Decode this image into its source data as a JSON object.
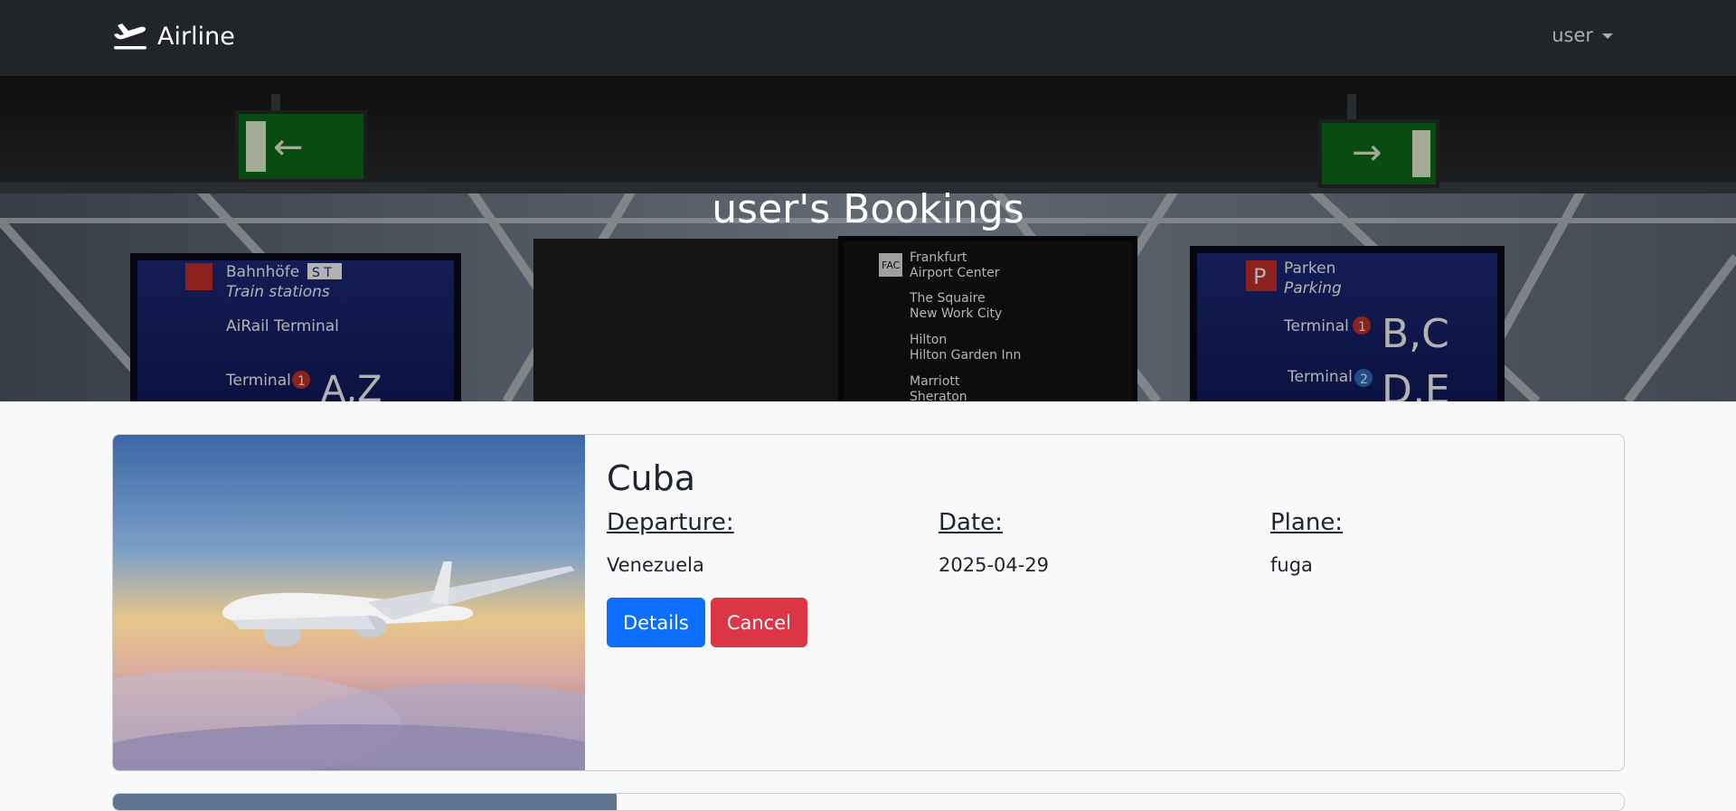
{
  "navbar": {
    "brand": "Airline",
    "brand_icon": "plane-departure-icon",
    "user_label": "user",
    "dropdown_icon": "caret-down-icon"
  },
  "hero": {
    "title": "user's Bookings",
    "background": "airport-signs-photo",
    "signs": {
      "left_stations_de": "Bahnhöfe",
      "left_stations_en": "Train stations",
      "left_airrail": "AiRail Terminal",
      "left_terminal": "Terminal",
      "left_terminal_number": "1",
      "left_gates": "A,Z",
      "mid_fac": "FAC",
      "mid_frankfurt": "Frankfurt",
      "mid_airport_center": "Airport Center",
      "mid_squaire": "The Squaire",
      "mid_newwork": "New Work City",
      "mid_hilton": "Hilton",
      "mid_hilton_garden": "Hilton Garden Inn",
      "mid_marriott": "Marriott",
      "mid_sheraton": "Sheraton",
      "right_parken": "Parken",
      "right_parking": "Parking",
      "right_terminal1": "Terminal",
      "right_terminal1_number": "1",
      "right_gates1": "B,C",
      "right_terminal2": "Terminal",
      "right_terminal2_number": "2",
      "right_gates2": "D,E",
      "st_badge": "S T",
      "parking_badge": "P"
    }
  },
  "bookings": [
    {
      "destination": "Cuba",
      "image": "airplane-above-clouds-photo",
      "departure_label": "Departure:",
      "departure": "Venezuela",
      "date_label": "Date:",
      "date": "2025-04-29",
      "plane_label": "Plane:",
      "plane": "fuga",
      "details_button": "Details",
      "cancel_button": "Cancel"
    }
  ],
  "colors": {
    "navbar_bg": "#212529",
    "primary": "#0d6efd",
    "danger": "#dc3545",
    "page_bg": "#f8f9fa"
  }
}
